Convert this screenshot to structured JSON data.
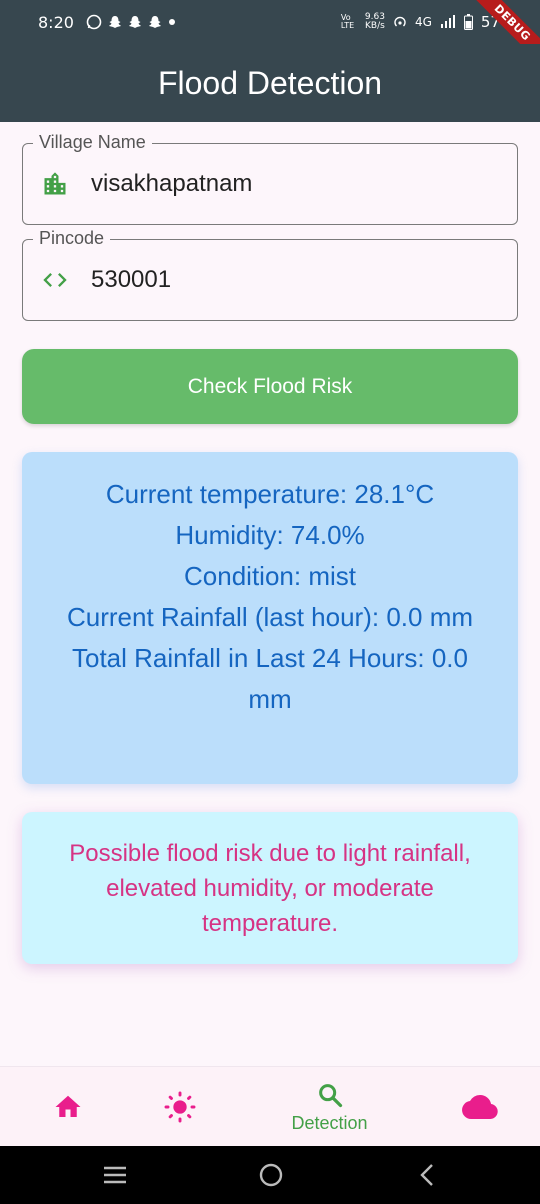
{
  "status_bar": {
    "time": "8:20",
    "network": "4G",
    "speed_value": "9.63",
    "speed_unit": "KB/s",
    "volte": "Vo LTE",
    "battery": "57",
    "debug_banner": "DEBUG"
  },
  "app_bar": {
    "title": "Flood Detection"
  },
  "form": {
    "village": {
      "label": "Village Name",
      "value": "visakhapatnam",
      "icon": "city-icon"
    },
    "pincode": {
      "label": "Pincode",
      "value": "530001",
      "icon": "code-icon"
    },
    "button_label": "Check Flood Risk"
  },
  "weather": {
    "lines": [
      "Current temperature: 28.1°C",
      "Humidity: 74.0%",
      "Condition: mist",
      "Current Rainfall (last hour): 0.0 mm",
      "Total Rainfall in Last 24 Hours: 0.0 mm"
    ]
  },
  "risk": {
    "message": "Possible flood risk due to light rainfall, elevated humidity, or moderate temperature."
  },
  "bottom_nav": {
    "items": [
      {
        "icon": "home-icon",
        "label": ""
      },
      {
        "icon": "sun-icon",
        "label": ""
      },
      {
        "icon": "search-icon",
        "label": "Detection"
      },
      {
        "icon": "cloud-icon",
        "label": ""
      }
    ],
    "active_index": 2
  },
  "colors": {
    "app_bar": "#37474f",
    "primary_green": "#66bb6a",
    "weather_card": "#bbdefb",
    "weather_text": "#1565c0",
    "risk_card": "#ccf5ff",
    "risk_text": "#d63384",
    "nav_icon": "#e91e8c"
  }
}
